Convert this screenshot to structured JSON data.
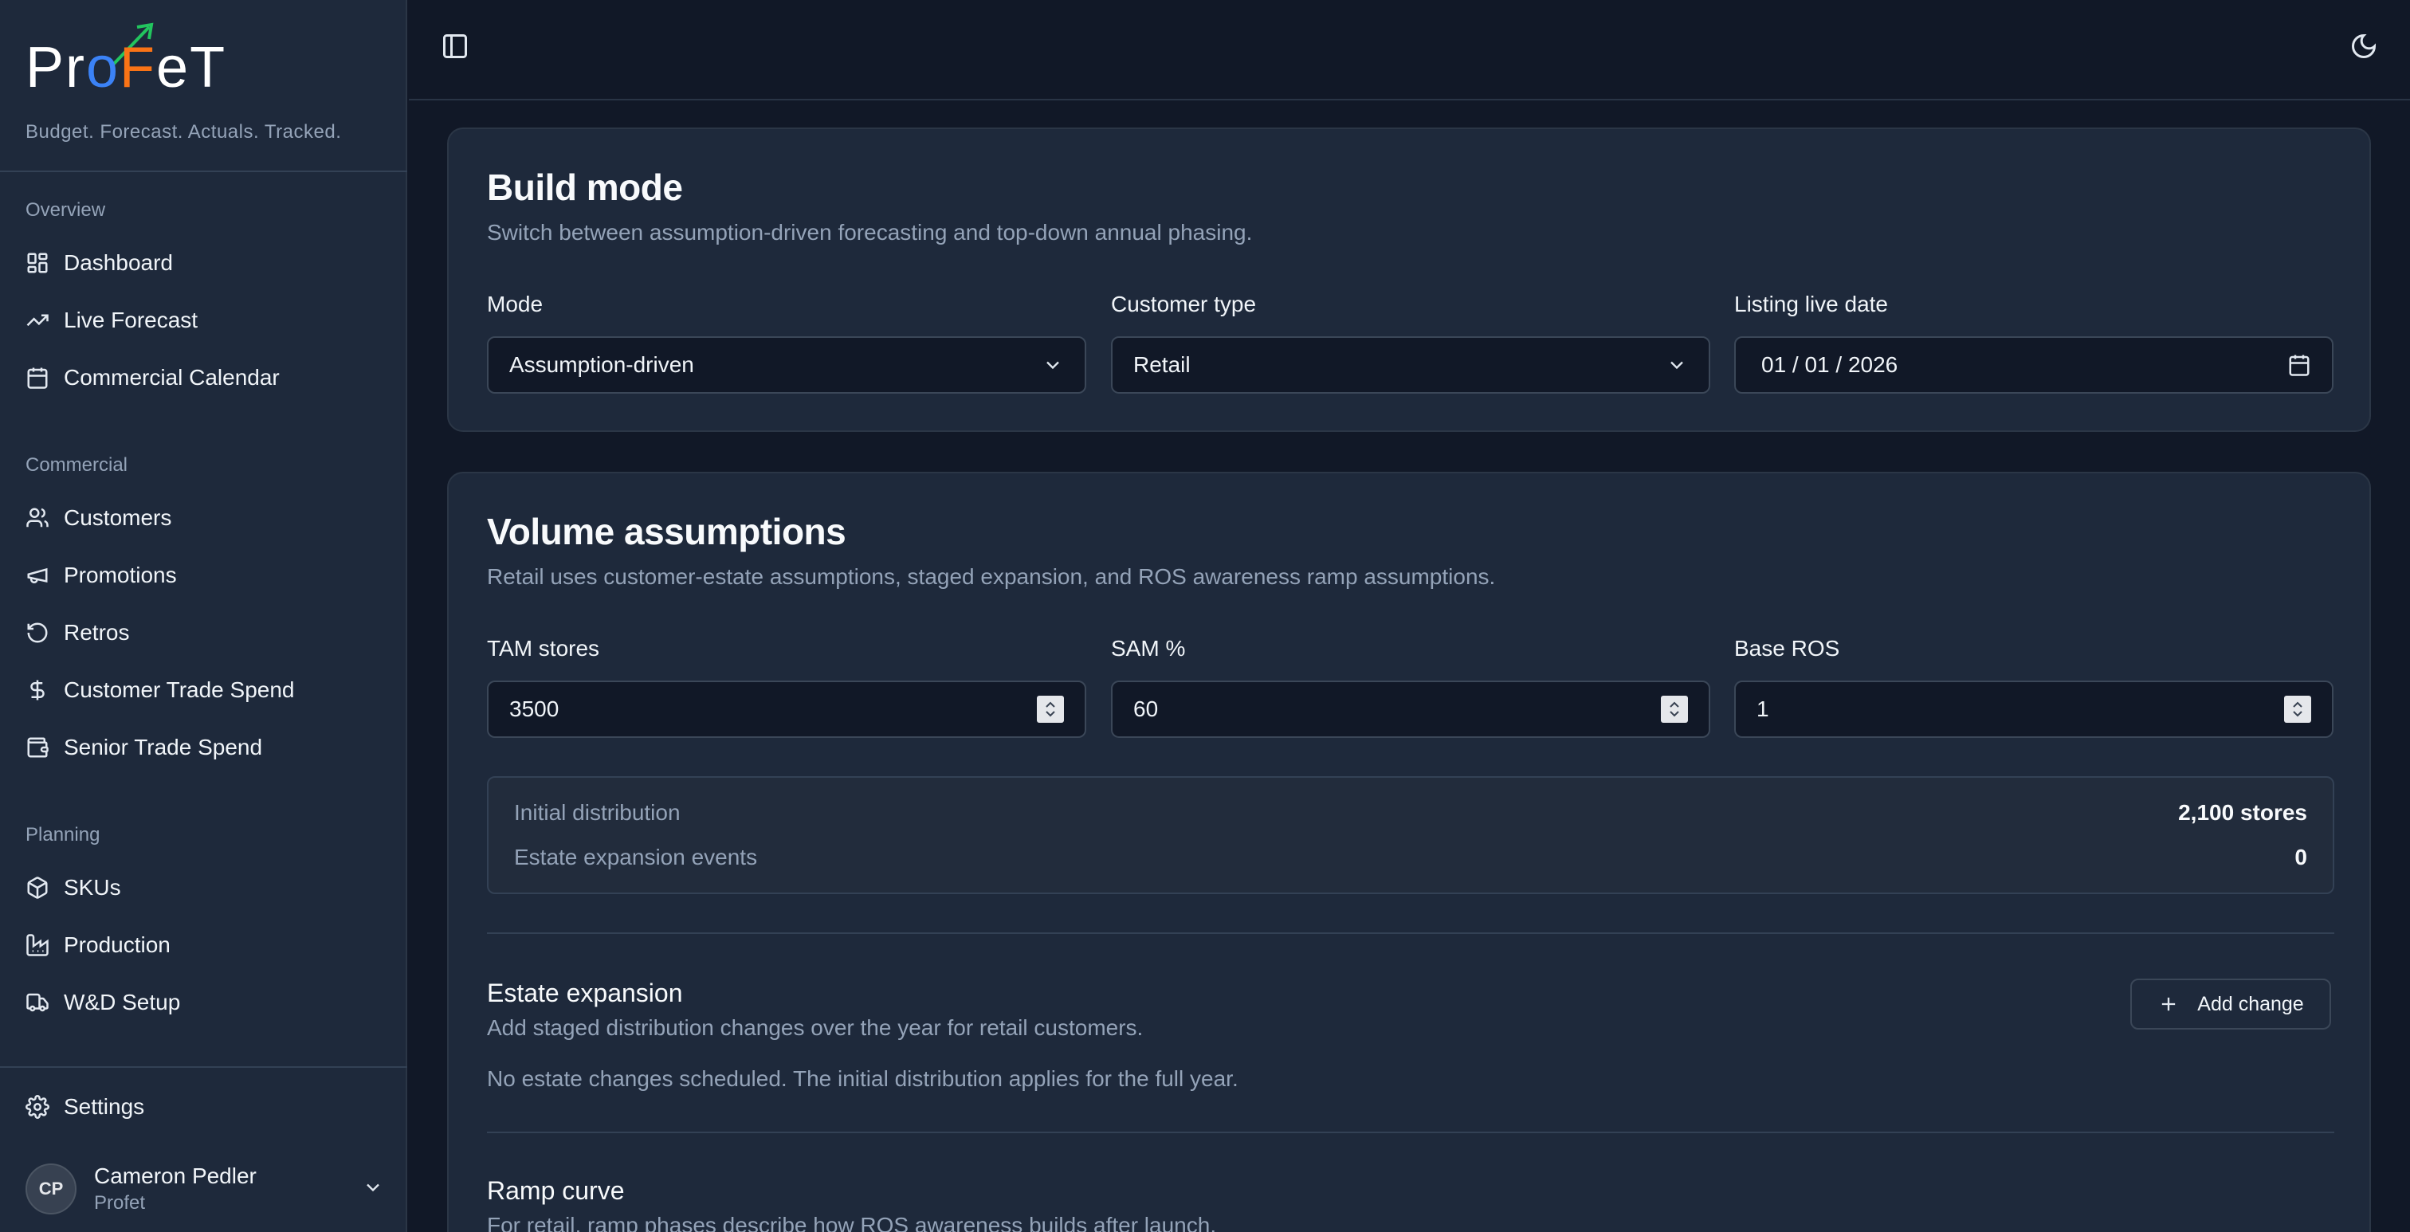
{
  "app": {
    "logo_text": "ProFeT",
    "tagline": "Budget. Forecast. Actuals. Tracked."
  },
  "sidebar": {
    "sections": [
      {
        "label": "Overview",
        "items": [
          {
            "label": "Dashboard",
            "icon": "dashboard-icon"
          },
          {
            "label": "Live Forecast",
            "icon": "trending-up-icon"
          },
          {
            "label": "Commercial Calendar",
            "icon": "calendar-icon"
          }
        ]
      },
      {
        "label": "Commercial",
        "items": [
          {
            "label": "Customers",
            "icon": "users-icon"
          },
          {
            "label": "Promotions",
            "icon": "megaphone-icon"
          },
          {
            "label": "Retros",
            "icon": "rotate-icon"
          },
          {
            "label": "Customer Trade Spend",
            "icon": "dollar-icon"
          },
          {
            "label": "Senior Trade Spend",
            "icon": "wallet-icon"
          }
        ]
      },
      {
        "label": "Planning",
        "items": [
          {
            "label": "SKUs",
            "icon": "package-icon"
          },
          {
            "label": "Production",
            "icon": "factory-icon"
          },
          {
            "label": "W&D Setup",
            "icon": "truck-icon"
          }
        ]
      }
    ],
    "settings_label": "Settings",
    "user": {
      "initials": "CP",
      "name": "Cameron Pedler",
      "org": "Profet"
    }
  },
  "build_mode": {
    "title": "Build mode",
    "description": "Switch between assumption-driven forecasting and top-down annual phasing.",
    "mode_label": "Mode",
    "mode_value": "Assumption-driven",
    "customer_type_label": "Customer type",
    "customer_type_value": "Retail",
    "listing_date_label": "Listing live date",
    "listing_date_value": "01 / 01 / 2026"
  },
  "volume": {
    "title": "Volume assumptions",
    "description": "Retail uses customer-estate assumptions, staged expansion, and ROS awareness ramp assumptions.",
    "tam_label": "TAM stores",
    "tam_value": "3500",
    "sam_label": "SAM %",
    "sam_value": "60",
    "ros_label": "Base ROS",
    "ros_value": "1",
    "initial_distribution_label": "Initial distribution",
    "initial_distribution_value": "2,100 stores",
    "expansion_events_label": "Estate expansion events",
    "expansion_events_value": "0",
    "estate_title": "Estate expansion",
    "estate_desc": "Add staged distribution changes over the year for retail customers.",
    "estate_empty": "No estate changes scheduled. The initial distribution applies for the full year.",
    "add_change_label": "Add change",
    "ramp_title": "Ramp curve",
    "ramp_desc": "For retail, ramp phases describe how ROS awareness builds after launch."
  }
}
